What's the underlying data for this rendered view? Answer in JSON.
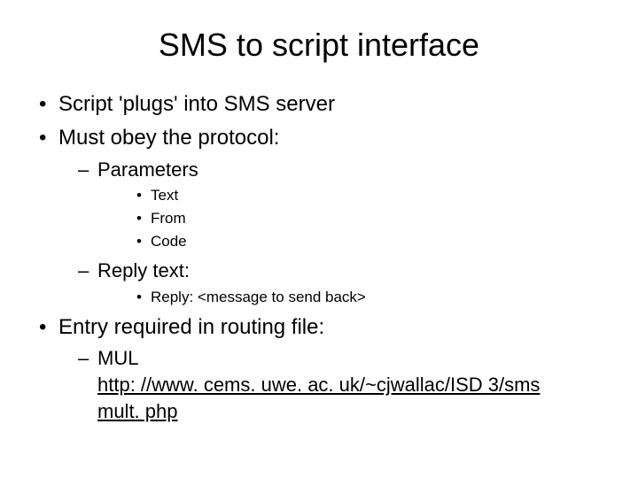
{
  "title": "SMS to script interface",
  "bullets": {
    "b1": "Script 'plugs' into SMS server",
    "b2": "Must obey the protocol:",
    "b2a": "Parameters",
    "b2a1": "Text",
    "b2a2": "From",
    "b2a3": "Code",
    "b2b": "Reply text:",
    "b2b1": "Reply: <message to send back>",
    "b3": "Entry required in routing file:",
    "b3a_label": "MUL",
    "b3a_link_part1": "http: //www. cems. uwe. ac. uk/~cjwallac/ISD 3/sms",
    "b3a_link_part2": "mult. php"
  }
}
